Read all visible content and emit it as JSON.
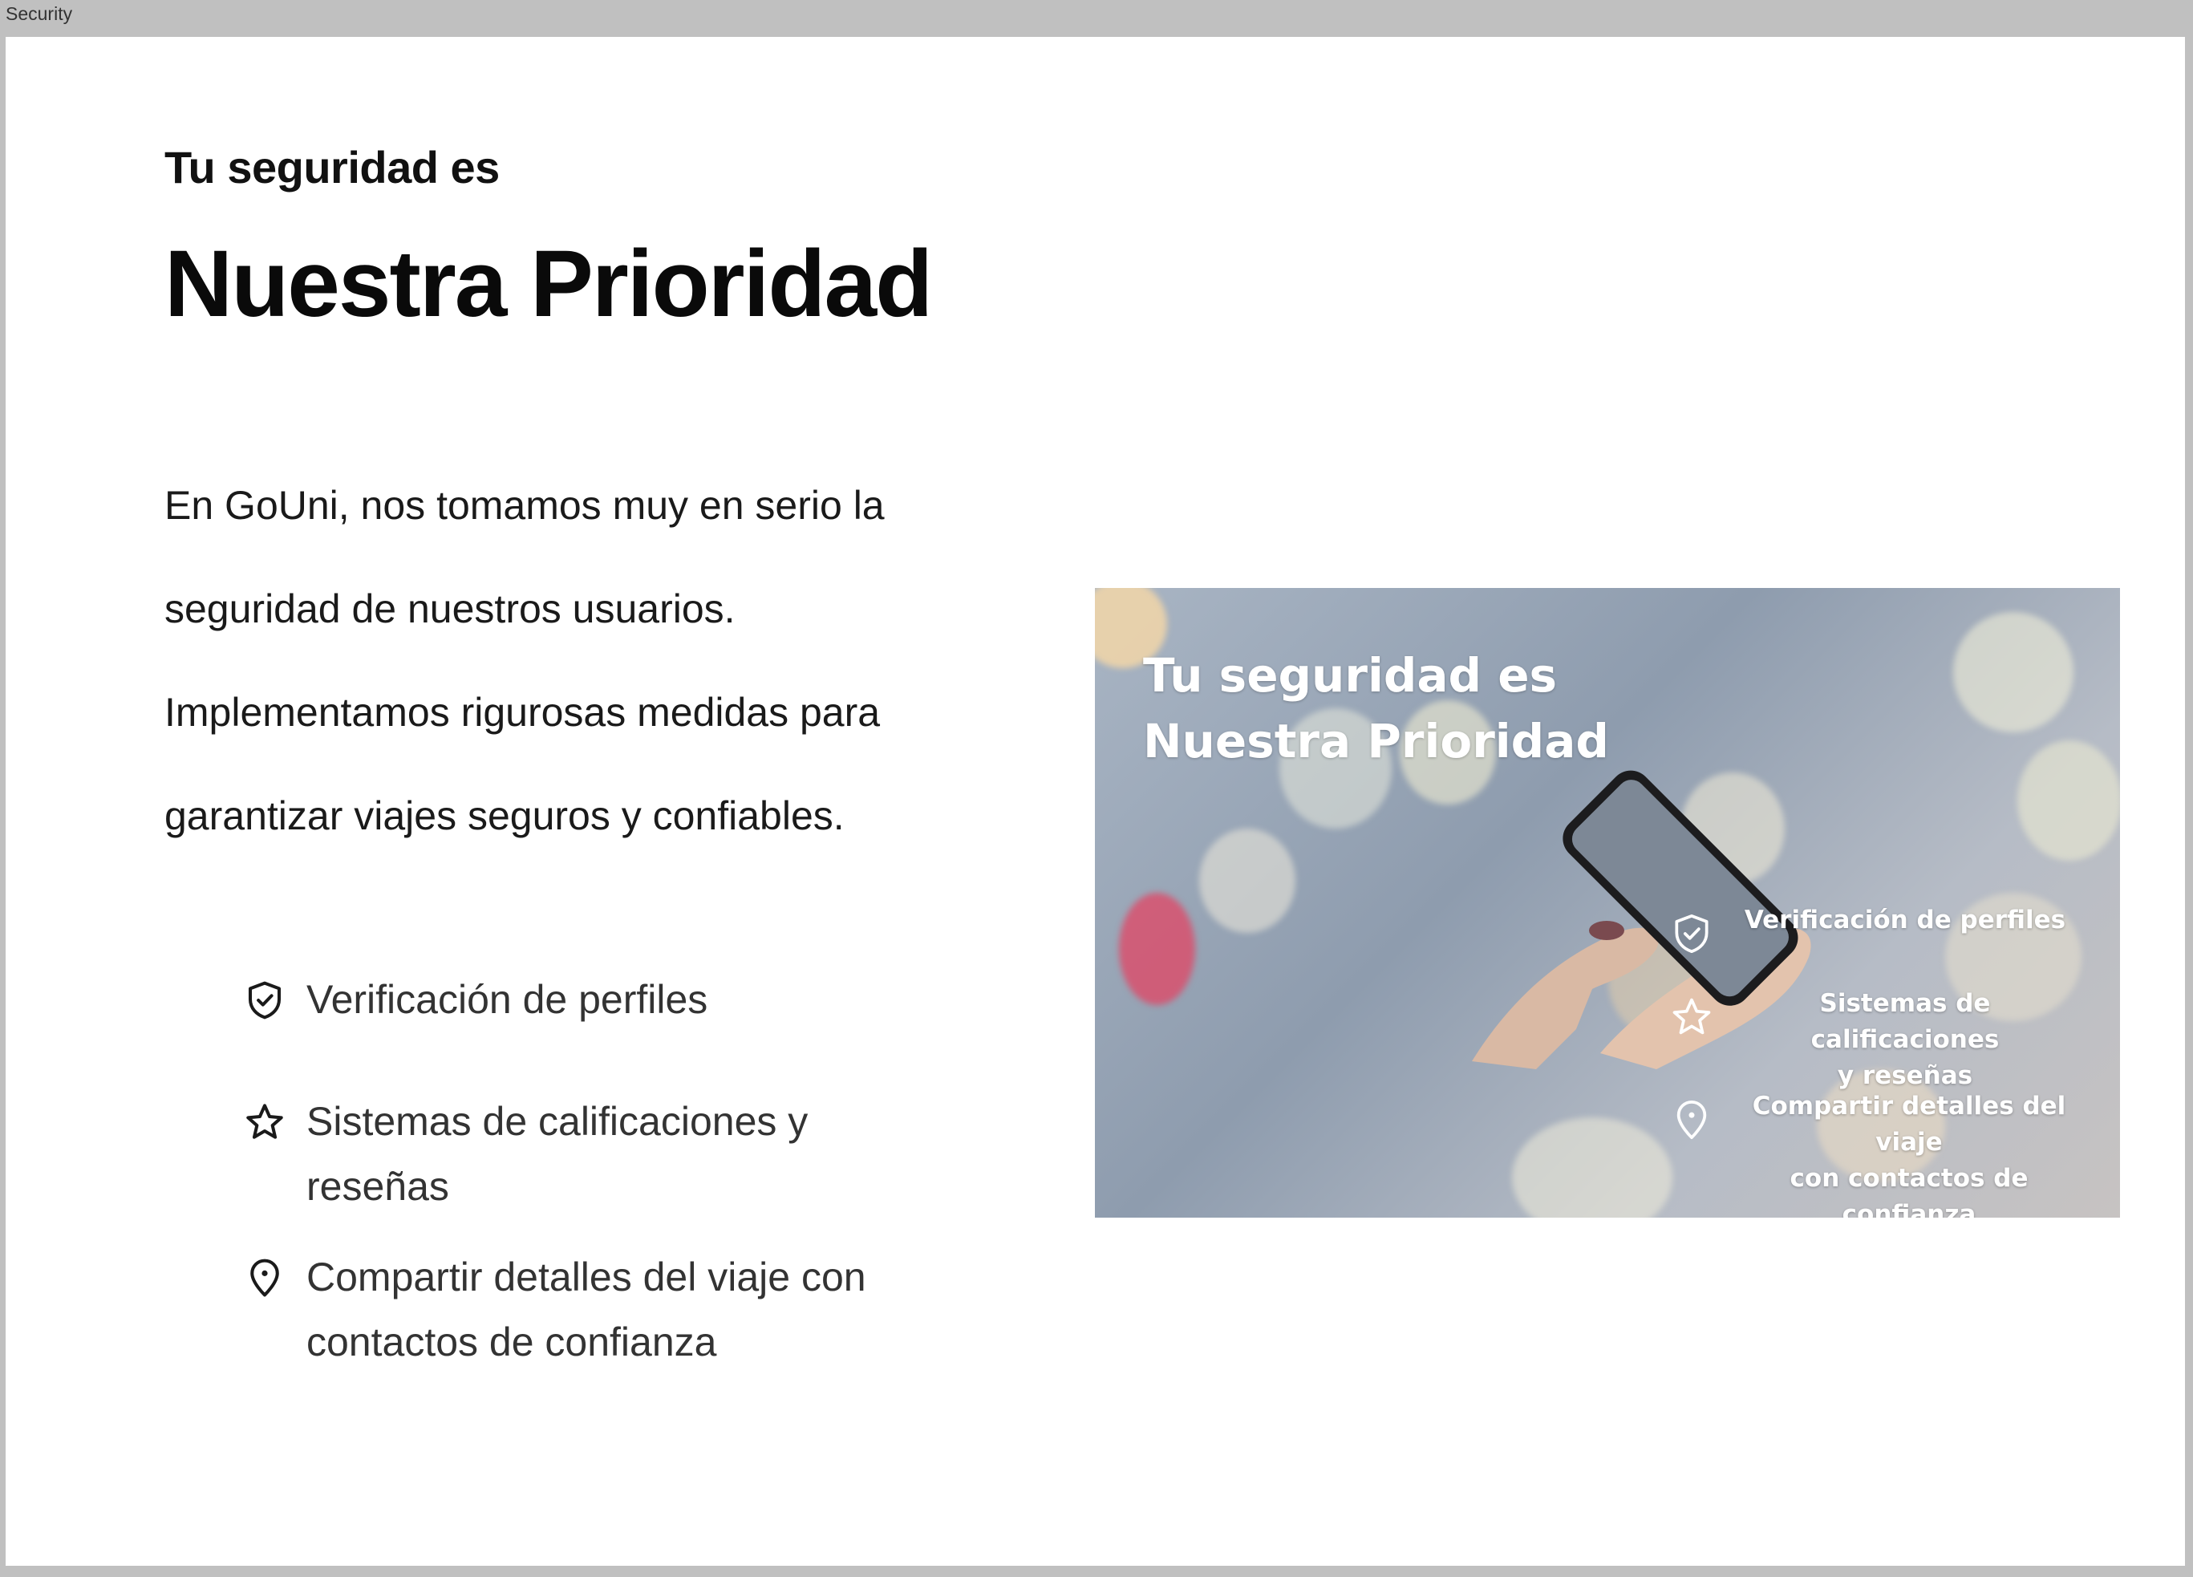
{
  "window": {
    "title": "Security"
  },
  "content": {
    "kicker": "Tu seguridad es",
    "headline": "Nuestra Prioridad",
    "intro_lines": [
      "En GoUni, nos tomamos muy en serio la",
      "seguridad de nuestros usuarios.",
      "Implementamos rigurosas medidas para",
      "garantizar viajes seguros y confiables."
    ],
    "features": [
      {
        "icon": "shield-check-icon",
        "label": "Verificación de perfiles"
      },
      {
        "icon": "star-icon",
        "label": "Sistemas de calificaciones y reseñas"
      },
      {
        "icon": "map-pin-icon",
        "label": "Compartir detalles del viaje con contactos de confianza"
      }
    ]
  },
  "hero_image": {
    "title_line1": "Tu seguridad es",
    "title_line2": "Nuestra Prioridad",
    "items": [
      {
        "icon": "shield-check-icon",
        "line1": "Verificación de perfiles",
        "line2": ""
      },
      {
        "icon": "star-icon",
        "line1": "Sistemas de calificaciones",
        "line2": "y reseñas"
      },
      {
        "icon": "map-pin-icon",
        "line1": "Compartir detalles del viaje",
        "line2": "con contactos de confianza"
      }
    ]
  }
}
